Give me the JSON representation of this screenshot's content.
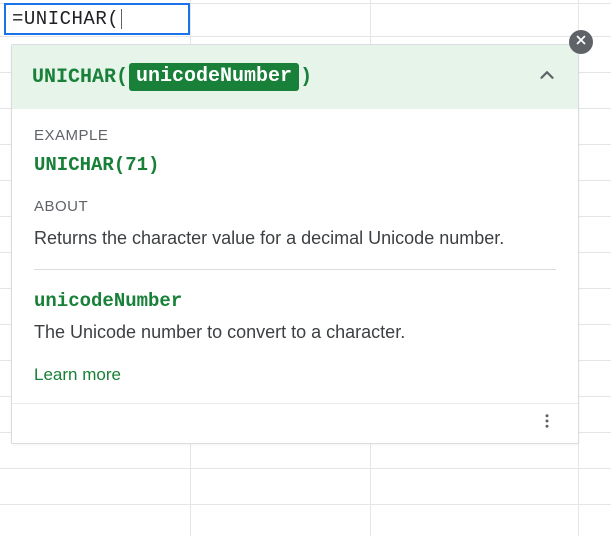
{
  "formula_input": "=UNICHAR(",
  "close_icon": "close",
  "tooltip": {
    "function_name": "UNICHAR",
    "open_paren": "(",
    "param_highlight": "unicodeNumber",
    "close_paren": ")",
    "collapse_icon": "chevron-up",
    "example_label": "EXAMPLE",
    "example_value": "UNICHAR(71)",
    "about_label": "ABOUT",
    "about_text": "Returns the character value for a decimal Unicode number.",
    "param_name": "unicodeNumber",
    "param_desc": "The Unicode number to convert to a character.",
    "learn_more": "Learn more",
    "more_icon": "more-vert"
  }
}
